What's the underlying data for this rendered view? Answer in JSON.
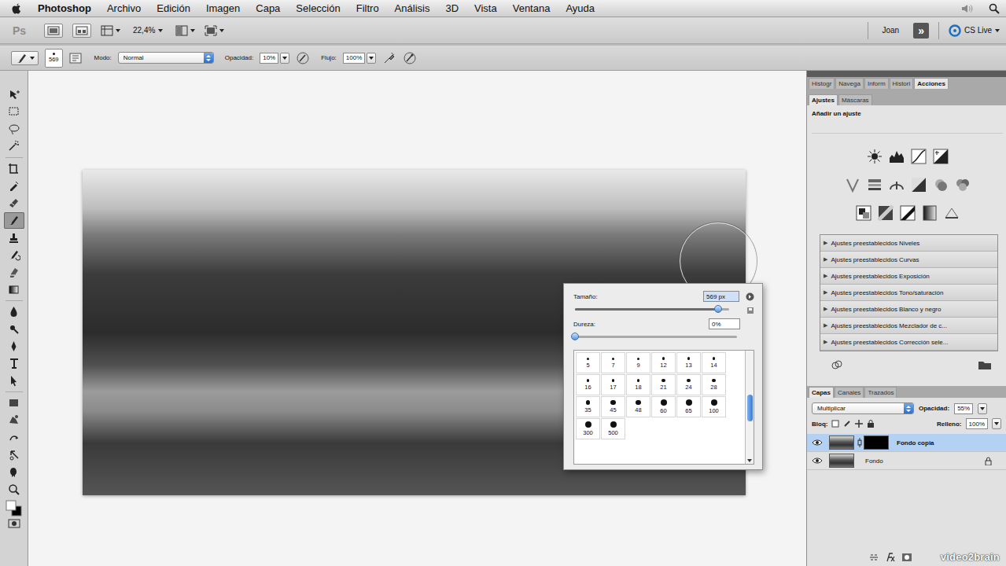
{
  "menu_bar": {
    "app": "Photoshop",
    "items": [
      "Archivo",
      "Edición",
      "Imagen",
      "Capa",
      "Selección",
      "Filtro",
      "Análisis",
      "3D",
      "Vista",
      "Ventana",
      "Ayuda"
    ]
  },
  "app_bar": {
    "logo": "Ps",
    "zoom": "22,4%",
    "user": "Joan",
    "expand": "»",
    "cs_live": "CS Live"
  },
  "options_bar": {
    "brush_size": "569",
    "mode_label": "Modo:",
    "mode": "Normal",
    "opacity_label": "Opacidad:",
    "opacity": "10%",
    "flow_label": "Flujo:",
    "flow": "100%"
  },
  "toolbar": {
    "tools": [
      {
        "selected": false
      },
      {
        "selected": false
      },
      {
        "selected": false
      },
      {
        "selected": false
      },
      {
        "selected": false
      },
      {
        "selected": false
      },
      {
        "selected": false
      },
      {
        "selected": true
      },
      {
        "selected": false
      },
      {
        "selected": false
      },
      {
        "selected": false
      },
      {
        "selected": false
      },
      {
        "selected": false
      },
      {
        "selected": false
      },
      {
        "selected": false
      },
      {
        "selected": false
      },
      {
        "selected": false
      },
      {
        "selected": false
      },
      {
        "selected": false
      },
      {
        "selected": false
      },
      {
        "selected": false
      },
      {
        "selected": false
      },
      {
        "selected": false
      }
    ]
  },
  "brush_picker": {
    "size_label": "Tamaño:",
    "size": "569 px",
    "size_level": 0.93,
    "hardness_label": "Dureza:",
    "hardness": "0%",
    "hardness_level": 0,
    "presets": [
      "5",
      "7",
      "9",
      "12",
      "13",
      "14",
      "16",
      "17",
      "18",
      "21",
      "24",
      "28",
      "35",
      "45",
      "48",
      "60",
      "65",
      "100",
      "300",
      "500"
    ]
  },
  "panel_tabs": [
    {
      "label": "Histogr",
      "selected": false
    },
    {
      "label": "Navega",
      "selected": false
    },
    {
      "label": "Inform",
      "selected": false
    },
    {
      "label": "Histori",
      "selected": false
    },
    {
      "label": "Acciones",
      "selected": true
    }
  ],
  "adjustments": {
    "tabs": [
      {
        "label": "Ajustes",
        "selected": true
      },
      {
        "label": "Máscaras",
        "selected": false
      }
    ],
    "title": "Añadir un ajuste",
    "presets": [
      {
        "arrow": "▶",
        "label": "Ajustes preestablecidos Niveles"
      },
      {
        "arrow": "▶",
        "label": "Ajustes preestablecidos Curvas"
      },
      {
        "arrow": "▶",
        "label": "Ajustes preestablecidos Exposición"
      },
      {
        "arrow": "▶",
        "label": "Ajustes preestablecidos Tono/saturación"
      },
      {
        "arrow": "▶",
        "label": "Ajustes preestablecidos Blanco y negro"
      },
      {
        "arrow": "▶",
        "label": "Ajustes preestablecidos Mezclador de c..."
      },
      {
        "arrow": "▶",
        "label": "Ajustes preestablecidos Corrección sele..."
      }
    ]
  },
  "layers_panel": {
    "tabs": [
      {
        "label": "Capas",
        "selected": true
      },
      {
        "label": "Canales",
        "selected": false
      },
      {
        "label": "Trazados",
        "selected": false
      }
    ],
    "blend_mode": "Multiplicar",
    "opacity_label": "Opacidad:",
    "opacity": "55%",
    "lock_label": "Bloq:",
    "fill_label": "Relleno:",
    "fill": "100%",
    "layers": [
      {
        "name": "Fondo copia",
        "selected": true,
        "visible": true,
        "locked": false,
        "has_mask": true
      },
      {
        "name": "Fondo",
        "selected": false,
        "visible": true,
        "locked": true,
        "has_mask": false
      }
    ]
  },
  "watermark": "video2brain"
}
